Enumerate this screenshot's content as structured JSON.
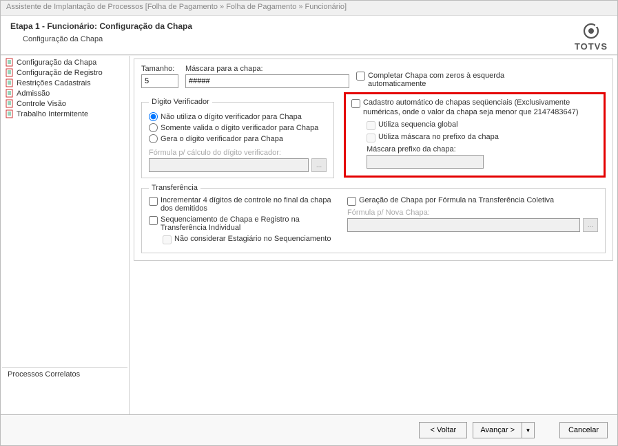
{
  "titlebar": "Assistente de Implantação de Processos [Folha de Pagamento » Folha de Pagamento » Funcionário]",
  "header": {
    "step": "Etapa 1 - Funcionário: Configuração da Chapa",
    "sub": "Configuração da Chapa",
    "brand": "TOTVS"
  },
  "sidebar": {
    "items": [
      {
        "label": "Configuração da Chapa"
      },
      {
        "label": "Configuração de Registro"
      },
      {
        "label": "Restrições Cadastrais"
      },
      {
        "label": "Admissão"
      },
      {
        "label": "Controle Visão"
      },
      {
        "label": "Trabalho Intermitente"
      }
    ],
    "processos": "Processos Correlatos"
  },
  "main": {
    "tamanho_label": "Tamanho:",
    "tamanho_value": "5",
    "mascara_label": "Máscara para a chapa:",
    "mascara_value": "#####",
    "completar_zeros": "Completar Chapa com zeros à esquerda automaticamente",
    "dv": {
      "legend": "Dígito Verificador",
      "r1": "Não utiliza o dígito verificador para Chapa",
      "r2": "Somente valida o dígito verificador para Chapa",
      "r3": "Gera o dígito verificador para Chapa",
      "formula_lbl": "Fórmula p/ cálculo do dígito verificador:"
    },
    "cad": {
      "title": "Cadastro automático de chapas seqüenciais (Exclusivamente numéricas, onde o valor da chapa seja menor que 2147483647)",
      "seq_global": "Utiliza sequencia global",
      "mask_prefixo": "Utiliza máscara no prefixo da chapa",
      "mask_prefixo_lbl": "Máscara prefixo da chapa:"
    },
    "transf": {
      "legend": "Transferência",
      "incr4": "Incrementar 4 dígitos de controle no final da chapa dos demitidos",
      "seq_reg": "Sequenciamento de Chapa e Registro na Transferência Individual",
      "nao_estag": "Não considerar Estagiário no Sequenciamento",
      "ger_formula": "Geração de Chapa por Fórmula na Transferência Coletiva",
      "formula_nova": "Fórmula p/ Nova Chapa:"
    }
  },
  "footer": {
    "voltar": "< Voltar",
    "avancar": "Avançar >",
    "cancelar": "Cancelar"
  }
}
